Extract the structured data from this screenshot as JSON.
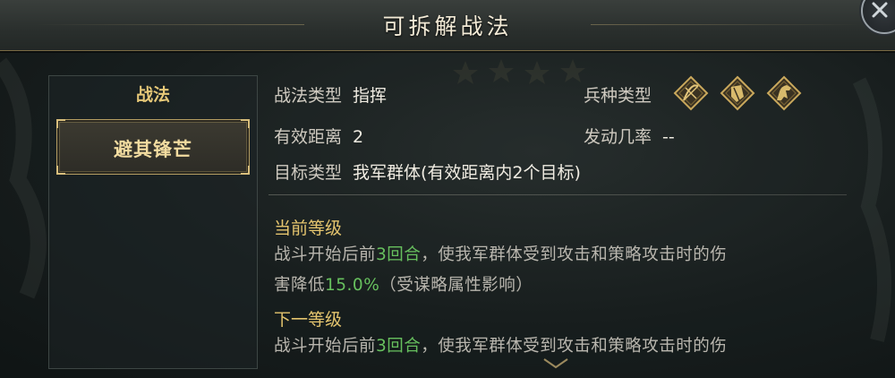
{
  "window": {
    "title": "可拆解战法"
  },
  "left_panel": {
    "header": "战法",
    "tactics": [
      {
        "name": "避其锋芒"
      }
    ]
  },
  "info": {
    "type_label": "战法类型",
    "type_value": "指挥",
    "range_label": "有效距离",
    "range_value": "2",
    "target_label": "目标类型",
    "target_value": "我军群体(有效距离内2个目标)",
    "unit_label": "兵种类型",
    "unit_icons": [
      "archer-icon",
      "shield-icon",
      "cavalry-icon"
    ],
    "rate_label": "发动几率",
    "rate_value": "--"
  },
  "current_level": {
    "title": "当前等级",
    "line1_pre": "战斗开始后前",
    "line1_hl": "3回合",
    "line1_post": "，使我军群体受到攻击和策略攻击时的伤",
    "line2_pre": "害降低",
    "line2_hl": "15.0%",
    "line2_post": "（受谋略属性影响）"
  },
  "next_level": {
    "title": "下一等级",
    "line1_pre": "战斗开始后前",
    "line1_hl": "3回合",
    "line1_post": "，使我军群体受到攻击和策略攻击时的伤"
  },
  "colors": {
    "accent_gold": "#e4c46e",
    "highlight_green": "#67c05e",
    "text_dim": "#b9b6ae"
  }
}
